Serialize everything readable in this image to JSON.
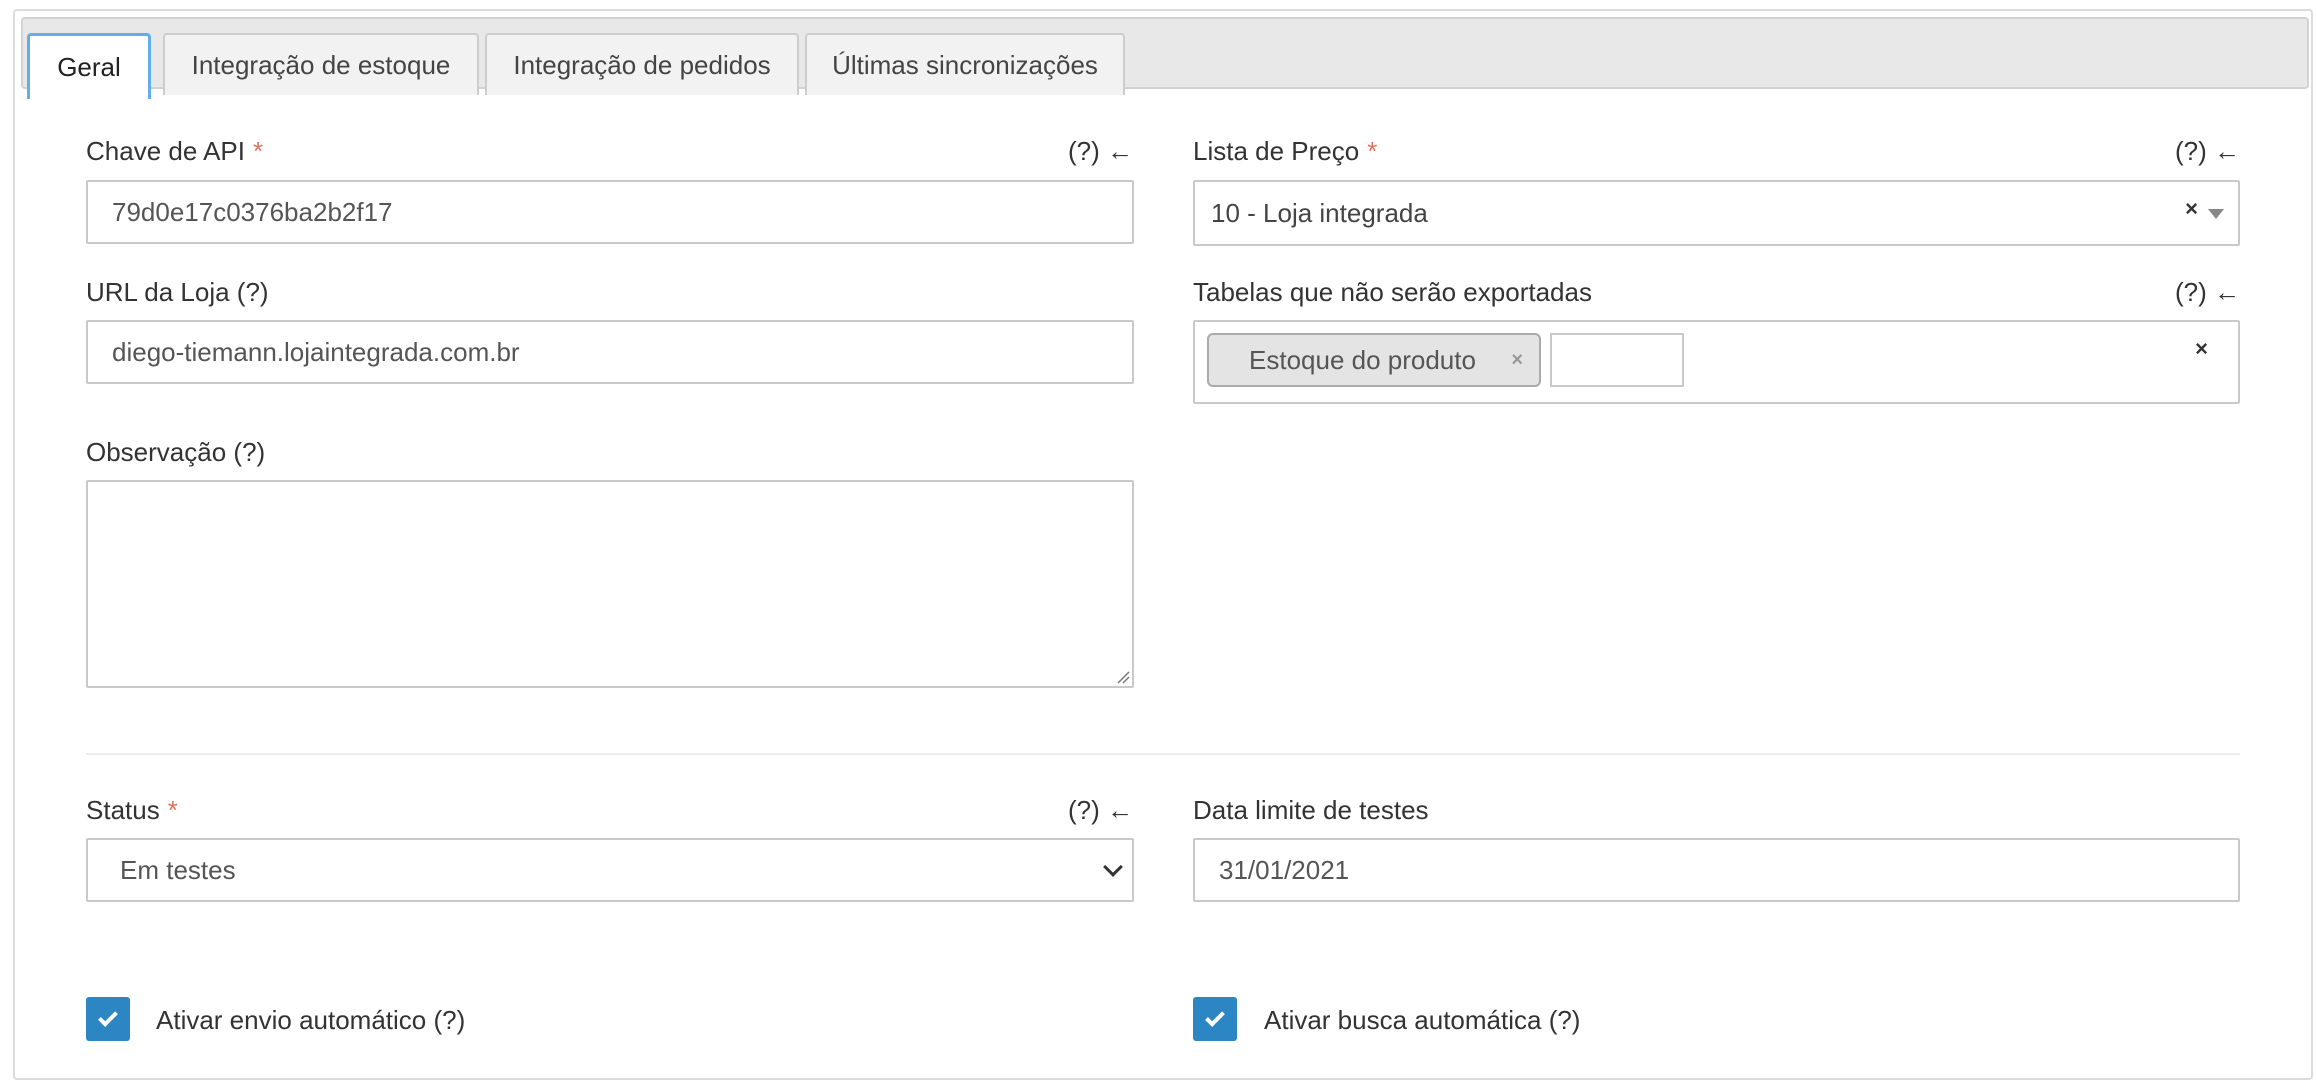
{
  "tabs": [
    {
      "label": "Geral",
      "active": true
    },
    {
      "label": "Integração de estoque",
      "active": false
    },
    {
      "label": "Integração de pedidos",
      "active": false
    },
    {
      "label": "Últimas sincronizações",
      "active": false
    }
  ],
  "form": {
    "api_key": {
      "label": "Chave de API",
      "required_mark": "*",
      "help": "(?) ←",
      "value": "79d0e17c0376ba2b2f17"
    },
    "price_list": {
      "label": "Lista de Preço",
      "required_mark": "*",
      "help": "(?) ←",
      "value": "10 - Loja integrada",
      "clear": "×"
    },
    "store_url": {
      "label": "URL da Loja (?)",
      "value": "diego-tiemann.lojaintegrada.com.br"
    },
    "excluded_tables": {
      "label": "Tabelas que não serão exportadas",
      "help": "(?) ←",
      "tags": [
        "Estoque do produto"
      ],
      "tag_remove": "×",
      "clear": "×"
    },
    "notes": {
      "label": "Observação (?)",
      "value": ""
    },
    "status": {
      "label": "Status",
      "required_mark": "*",
      "help": "(?) ←",
      "value": "Em testes"
    },
    "test_deadline": {
      "label": "Data limite de testes",
      "value": "31/01/2021"
    },
    "auto_send": {
      "label": "Ativar envio automático (?)",
      "checked": true
    },
    "auto_fetch": {
      "label": "Ativar busca automática (?)",
      "checked": true
    }
  },
  "colors": {
    "accent": "#2c86c3",
    "tab_active_border": "#63aee9",
    "required": "#e0725a"
  }
}
